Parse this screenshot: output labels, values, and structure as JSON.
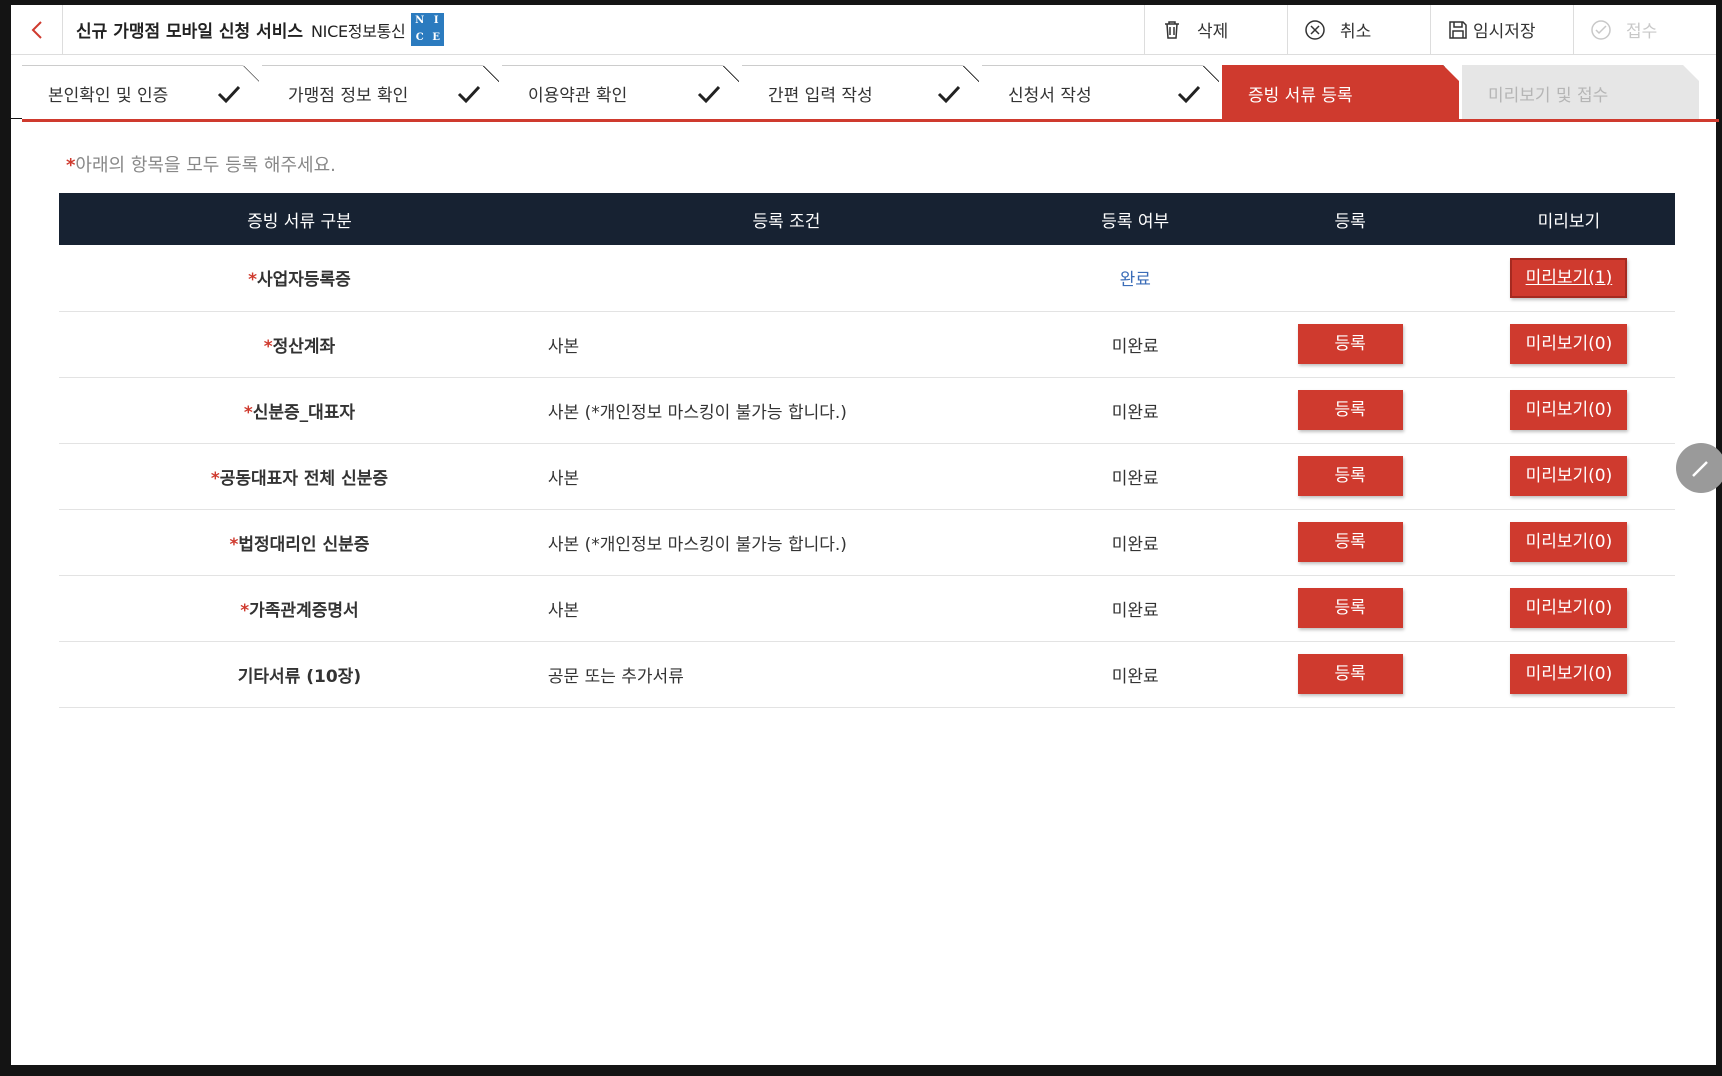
{
  "header": {
    "back_icon": "chevron-left-icon",
    "title": "신규 가맹점 모바일 신청 서비스",
    "brand_text": "NICE정보통신",
    "brand_logo_letters": [
      "N",
      "I",
      "C",
      "E"
    ],
    "actions": [
      {
        "label": "삭제",
        "icon": "trash-icon",
        "enabled": true
      },
      {
        "label": "취소",
        "icon": "cancel-circle-icon",
        "enabled": true
      },
      {
        "label": "임시저장",
        "icon": "save-icon",
        "enabled": true
      },
      {
        "label": "접수",
        "icon": "check-circle-icon",
        "enabled": false
      }
    ]
  },
  "steps": [
    {
      "label": "본인확인 및 인증",
      "state": "done"
    },
    {
      "label": "가맹점 정보 확인",
      "state": "done"
    },
    {
      "label": "이용약관 확인",
      "state": "done"
    },
    {
      "label": "간편 입력 작성",
      "state": "done"
    },
    {
      "label": "신청서 작성",
      "state": "done"
    },
    {
      "label": "증빙 서류 등록",
      "state": "active"
    },
    {
      "label": "미리보기 및 접수",
      "state": "pending"
    }
  ],
  "notice": {
    "star": "*",
    "text": "아래의 항목을 모두 등록 해주세요."
  },
  "table": {
    "headers": [
      "증빙 서류 구분",
      "등록 조건",
      "등록 여부",
      "등록",
      "미리보기"
    ],
    "rows": [
      {
        "required": "*",
        "name": "사업자등록증",
        "condition": "",
        "status": "완료",
        "done": true,
        "register": "",
        "preview": "미리보기(1)"
      },
      {
        "required": "*",
        "name": "정산계좌",
        "condition": "사본",
        "status": "미완료",
        "done": false,
        "register": "등록",
        "preview": "미리보기(0)"
      },
      {
        "required": "*",
        "name": "신분증_대표자",
        "condition": "사본 (*개인정보 마스킹이 불가능 합니다.)",
        "status": "미완료",
        "done": false,
        "register": "등록",
        "preview": "미리보기(0)"
      },
      {
        "required": "*",
        "name": "공동대표자 전체 신분증",
        "condition": "사본",
        "status": "미완료",
        "done": false,
        "register": "등록",
        "preview": "미리보기(0)"
      },
      {
        "required": "*",
        "name": "법정대리인 신분증",
        "condition": "사본 (*개인정보 마스킹이 불가능 합니다.)",
        "status": "미완료",
        "done": false,
        "register": "등록",
        "preview": "미리보기(0)"
      },
      {
        "required": "*",
        "name": "가족관계증명서",
        "condition": "사본",
        "status": "미완료",
        "done": false,
        "register": "등록",
        "preview": "미리보기(0)"
      },
      {
        "required": "",
        "name": "기타서류 (10장)",
        "condition": "공문 또는 추가서류",
        "status": "미완료",
        "done": false,
        "register": "등록",
        "preview": "미리보기(0)"
      }
    ]
  },
  "fab": {
    "icon": "pencil-icon"
  },
  "colors": {
    "accent": "#cf3a2e",
    "header_dark": "#172232",
    "done_blue": "#3b6db8"
  }
}
